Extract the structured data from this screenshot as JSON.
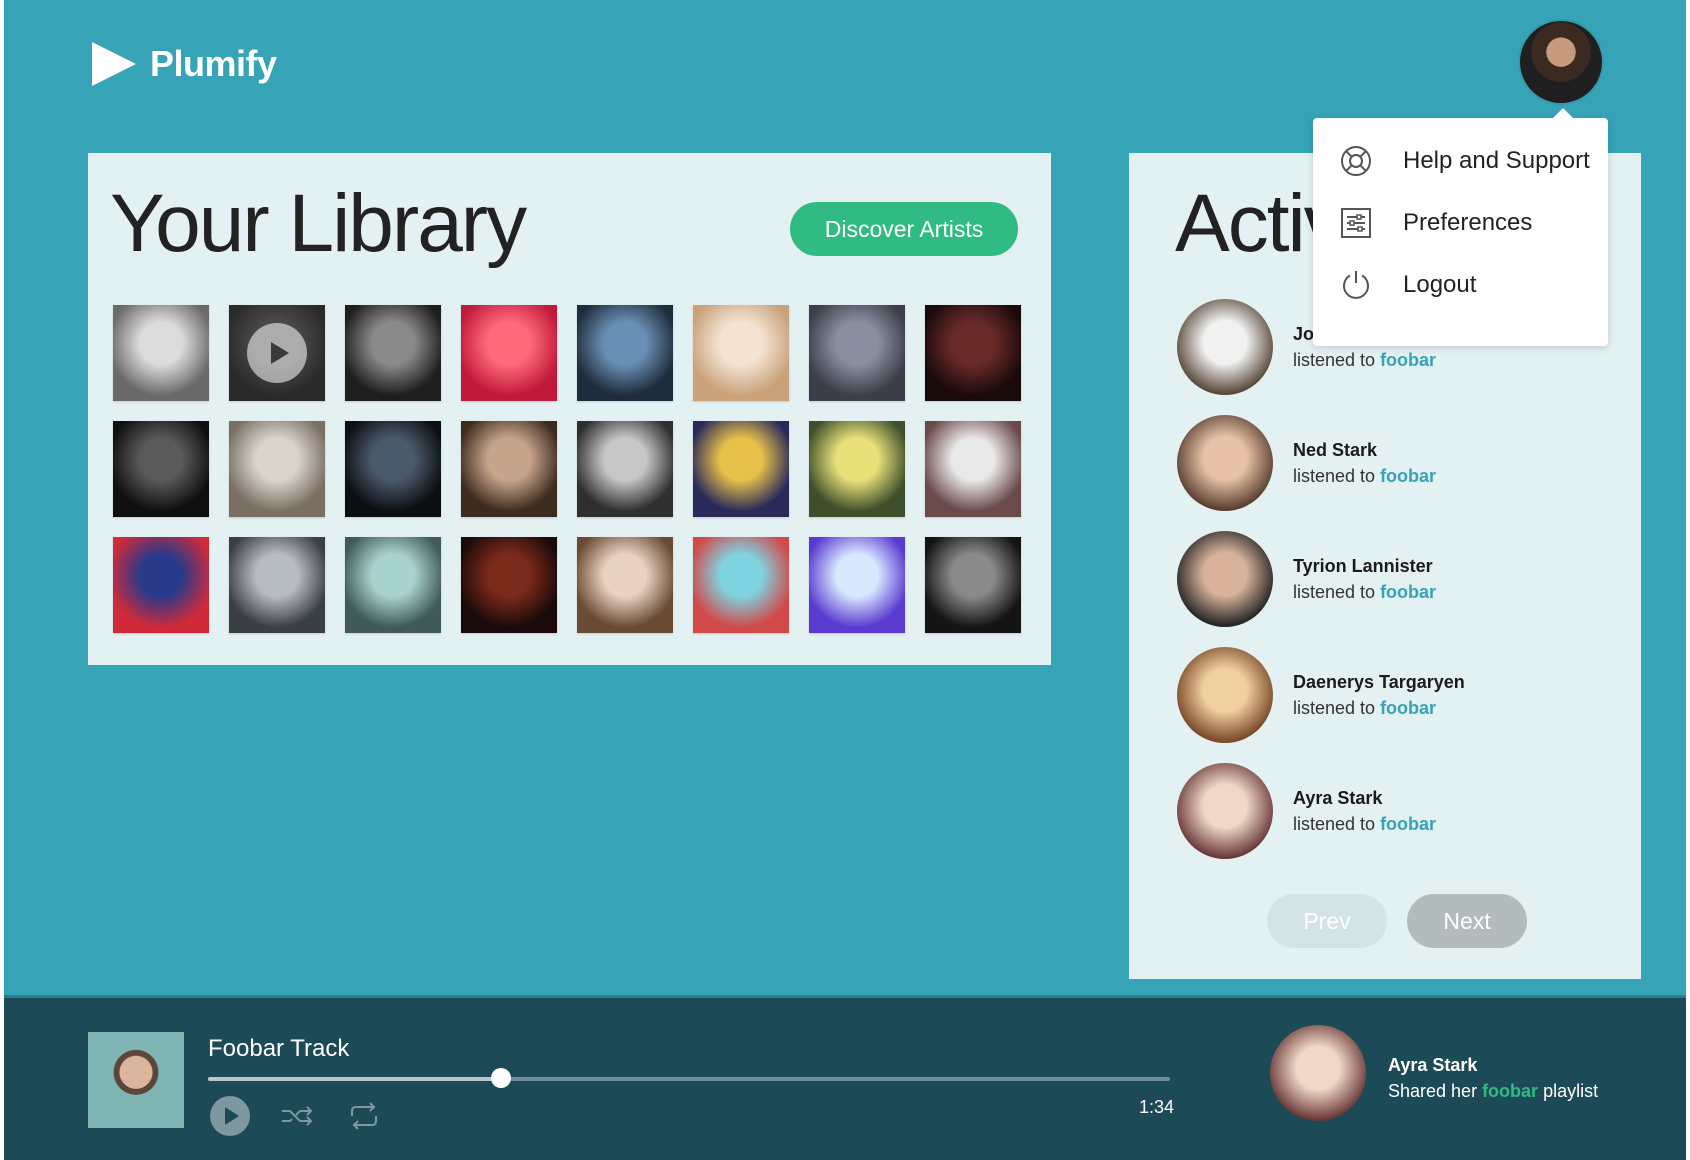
{
  "app": {
    "name": "Plumify"
  },
  "library": {
    "title": "Your Library",
    "discover_label": "Discover Artists",
    "tiles": [
      {
        "label": "artist-1",
        "c1": "#dcdcdc",
        "c2": "#6a6a6a"
      },
      {
        "label": "artist-2",
        "c1": "#4a4a4a",
        "c2": "#2a2a2a",
        "play": true
      },
      {
        "label": "artist-3",
        "c1": "#8a8a8a",
        "c2": "#1e1e1e"
      },
      {
        "label": "artist-4",
        "c1": "#ff6a7a",
        "c2": "#c01a3a"
      },
      {
        "label": "artist-5",
        "c1": "#6a8fb5",
        "c2": "#1f2c3b"
      },
      {
        "label": "artist-6",
        "c1": "#f4e4d4",
        "c2": "#c9a27a"
      },
      {
        "label": "artist-7",
        "c1": "#8a8f9f",
        "c2": "#3c3f4a"
      },
      {
        "label": "artist-8",
        "c1": "#6a2a2a",
        "c2": "#1a0a0a"
      },
      {
        "label": "artist-9",
        "c1": "#5a5a5a",
        "c2": "#0f0f0f"
      },
      {
        "label": "artist-10",
        "c1": "#d9d4cc",
        "c2": "#7a6f63"
      },
      {
        "label": "artist-11",
        "c1": "#4a5a6a",
        "c2": "#0c0f12"
      },
      {
        "label": "artist-12",
        "c1": "#c7a58b",
        "c2": "#3e2b1f"
      },
      {
        "label": "artist-13",
        "c1": "#c7c7c7",
        "c2": "#2f2f2f"
      },
      {
        "label": "artist-14",
        "c1": "#e7c14a",
        "c2": "#2a2a5a"
      },
      {
        "label": "artist-15",
        "c1": "#e8e17a",
        "c2": "#3f4f2a"
      },
      {
        "label": "artist-16",
        "c1": "#e9e9e9",
        "c2": "#6b4a4a"
      },
      {
        "label": "artist-17",
        "c1": "#2a3a8a",
        "c2": "#d02a3a"
      },
      {
        "label": "artist-18",
        "c1": "#b7bcc2",
        "c2": "#3a3f44"
      },
      {
        "label": "artist-19",
        "c1": "#a9d3cf",
        "c2": "#3f5a57"
      },
      {
        "label": "artist-20",
        "c1": "#7a2a1a",
        "c2": "#1a0a0a"
      },
      {
        "label": "artist-21",
        "c1": "#e9d2c2",
        "c2": "#6a4a32"
      },
      {
        "label": "artist-22",
        "c1": "#7fd3e0",
        "c2": "#d04a4a"
      },
      {
        "label": "artist-23",
        "c1": "#d7e8ff",
        "c2": "#5a3ad0"
      },
      {
        "label": "artist-24",
        "c1": "#8a8a8a",
        "c2": "#141414"
      }
    ]
  },
  "activity": {
    "title": "Activity",
    "items": [
      {
        "name": "John Snow",
        "action": "listened to ",
        "link": "foobar",
        "c1": "#f1f1f1",
        "c2": "#5a4a3a"
      },
      {
        "name": "Ned Stark",
        "action": "listened to ",
        "link": "foobar",
        "c1": "#e8c2a6",
        "c2": "#5a4030"
      },
      {
        "name": "Tyrion Lannister",
        "action": "listened to ",
        "link": "foobar",
        "c1": "#d8b39a",
        "c2": "#262626"
      },
      {
        "name": "Daenerys Targaryen",
        "action": "listened to ",
        "link": "foobar",
        "c1": "#f1d0a0",
        "c2": "#7a4a2a"
      },
      {
        "name": "Ayra Stark",
        "action": "listened to ",
        "link": "foobar",
        "c1": "#f0d8c8",
        "c2": "#6a3a3a"
      }
    ],
    "prev_label": "Prev",
    "next_label": "Next"
  },
  "menu": {
    "items": [
      {
        "label": "Help and Support",
        "icon": "lifebuoy-icon"
      },
      {
        "label": "Preferences",
        "icon": "sliders-icon"
      },
      {
        "label": "Logout",
        "icon": "power-icon"
      }
    ]
  },
  "player": {
    "track_title": "Foobar Track",
    "time": "1:34",
    "progress": 0.305
  },
  "share": {
    "name": "Ayra Stark",
    "text_before": "Shared her ",
    "link": "foobar",
    "text_after": " playlist"
  },
  "colors": {
    "background": "#36a3b6",
    "accent_green": "#30bb82",
    "link_teal": "#36a3b6",
    "footer": "#1c4a56"
  }
}
